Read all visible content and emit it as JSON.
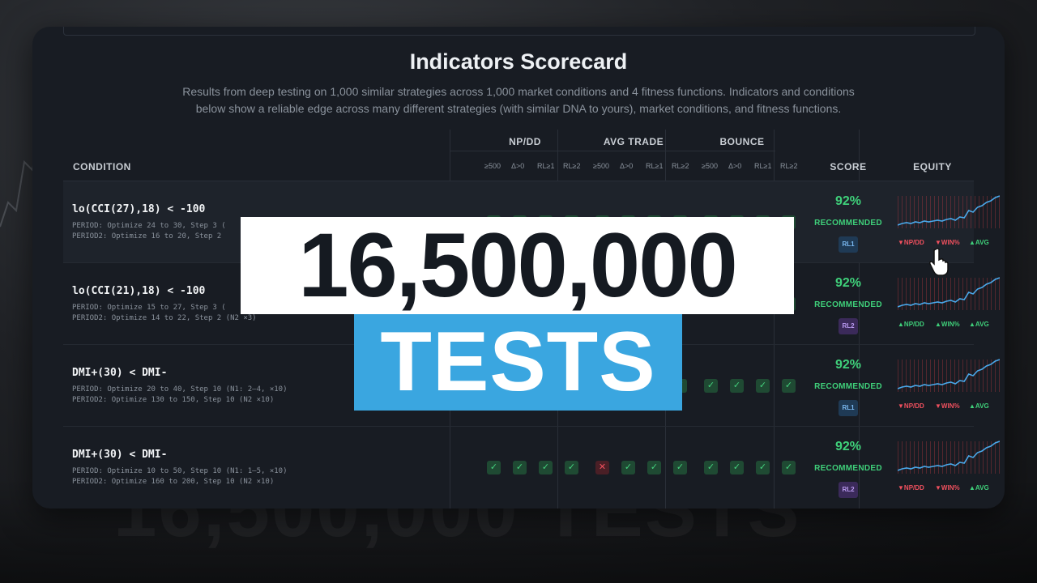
{
  "title": "Indicators Scorecard",
  "subtitle_line1": "Results from deep testing on 1,000 similar strategies across 1,000 market conditions and 4 fitness functions. Indicators and conditions",
  "subtitle_line2": "below show a reliable edge across many different strategies (with similar DNA to yours), market conditions, and fitness functions.",
  "headers": {
    "condition": "CONDITION",
    "npdd": "NP/DD",
    "avg_trade": "AVG TRADE",
    "bounce": "BOUNCE",
    "score": "SCORE",
    "equity": "EQUITY",
    "sub": [
      "≥500",
      "Δ>0",
      "RL≥1",
      "RL≥2",
      "≥500",
      "Δ>0",
      "RL≥1",
      "RL≥2",
      "≥500",
      "Δ>0",
      "RL≥1",
      "RL≥2"
    ]
  },
  "rows": [
    {
      "condition": "lo(CCI(27),18) < -100",
      "param1": "PERIOD: Optimize 24 to 30, Step 3 (",
      "param2": "PERIOD2: Optimize 16 to 20, Step 2",
      "score": "92%",
      "rec": "RECOMMENDED",
      "badge": "RL1",
      "legend": [
        "▼NP/DD",
        "▼WIN%",
        "▲AVG"
      ],
      "checks": [
        "ok",
        "ok",
        "ok",
        "ok",
        "ok",
        "ok",
        "ok",
        "ok",
        "ok",
        "ok",
        "ok",
        "ok"
      ]
    },
    {
      "condition": "lo(CCI(21),18) < -100",
      "param1": "PERIOD: Optimize 15 to 27, Step 3 (",
      "param2": "PERIOD2: Optimize 14 to 22, Step 2 (N2 ×3)",
      "score": "92%",
      "rec": "RECOMMENDED",
      "badge": "RL2",
      "legend": [
        "▲NP/DD",
        "▲WIN%",
        "▲AVG"
      ],
      "checks": [
        "ok",
        "ok",
        "ok",
        "ok",
        "ok",
        "ok",
        "ok",
        "ok",
        "ok",
        "ok",
        "ok",
        "ok"
      ]
    },
    {
      "condition": "DMI+(30) < DMI-",
      "param1": "PERIOD: Optimize 20 to 40, Step 10 (N1: 2–4, ×10)",
      "param2": "PERIOD2: Optimize 130 to 150, Step 10 (N2 ×10)",
      "score": "92%",
      "rec": "RECOMMENDED",
      "badge": "RL1",
      "legend": [
        "▼NP/DD",
        "▼WIN%",
        "▲AVG"
      ],
      "checks": [
        "ok",
        "ok",
        "ok",
        "ok",
        "ok",
        "ok",
        "ok",
        "ok",
        "ok",
        "ok",
        "ok",
        "ok"
      ]
    },
    {
      "condition": "DMI+(30) < DMI-",
      "param1": "PERIOD: Optimize 10 to 50, Step 10 (N1: 1–5, ×10)",
      "param2": "PERIOD2: Optimize 160 to 200, Step 10 (N2 ×10)",
      "score": "92%",
      "rec": "RECOMMENDED",
      "badge": "RL2",
      "legend": [
        "▼NP/DD",
        "▼WIN%",
        "▲AVG"
      ],
      "checks": [
        "ok",
        "ok",
        "ok",
        "ok",
        "no",
        "ok",
        "ok",
        "ok",
        "ok",
        "ok",
        "ok",
        "ok"
      ]
    }
  ],
  "overlay": {
    "count": "16,500,000",
    "label": "TESTS",
    "ghost": "16,500,000 TESTS"
  },
  "colors": {
    "accent_blue": "#3aa6e0",
    "green": "#3fd07a",
    "red": "#f0505e"
  },
  "icons": [
    "check-icon",
    "cross-icon",
    "hand-cursor-icon"
  ]
}
